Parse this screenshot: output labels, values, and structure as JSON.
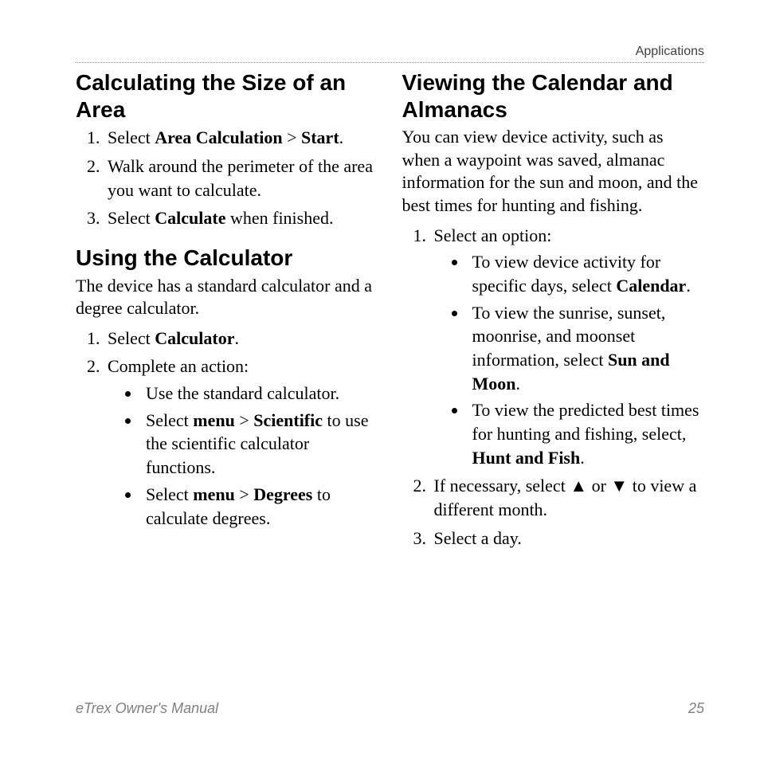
{
  "header": {
    "section": "Applications"
  },
  "col1": {
    "h1": "Calculating the Size of an Area",
    "step1_pre": "Select ",
    "step1_b1": "Area Calculation",
    "step1_mid": " > ",
    "step1_b2": "Start",
    "step1_post": ".",
    "step2": "Walk around the perimeter of the area you want to calculate.",
    "step3_pre": "Select ",
    "step3_b1": "Calculate",
    "step3_post": " when finished.",
    "h2": "Using the Calculator",
    "p2": "The device has a standard calculator and a degree calculator.",
    "calc_step1_pre": "Select ",
    "calc_step1_b": "Calculator",
    "calc_step1_post": ".",
    "calc_step2": "Complete an action:",
    "calc_b1": "Use the standard calculator.",
    "calc_b2_pre": "Select ",
    "calc_b2_b1": "menu",
    "calc_b2_mid": " > ",
    "calc_b2_b2": "Scientific",
    "calc_b2_post": " to use the scientific calculator functions.",
    "calc_b3_pre": "Select ",
    "calc_b3_b1": "menu",
    "calc_b3_mid": " > ",
    "calc_b3_b2": "Degrees",
    "calc_b3_post": " to calculate degrees."
  },
  "col2": {
    "h1": "Viewing the Calendar and Almanacs",
    "p1": "You can view device activity, such as when a waypoint was saved, almanac information for the sun and moon, and the best times for hunting and fishing.",
    "step1": "Select an option:",
    "opt1_pre": "To view device activity for specific days, select ",
    "opt1_b": "Calendar",
    "opt1_post": ".",
    "opt2_pre": "To view the sunrise, sunset, moonrise, and moonset information, select ",
    "opt2_b": "Sun and Moon",
    "opt2_post": ".",
    "opt3_pre": "To view the predicted best times for hunting and fishing, select, ",
    "opt3_b": "Hunt and Fish",
    "opt3_post": ".",
    "step2_pre": "If necessary, select ",
    "step2_up": "▲",
    "step2_mid": " or ",
    "step2_down": "▼",
    "step2_post": " to view a different month.",
    "step3": "Select a day."
  },
  "footer": {
    "manual": "eTrex Owner's Manual",
    "page": "25"
  }
}
